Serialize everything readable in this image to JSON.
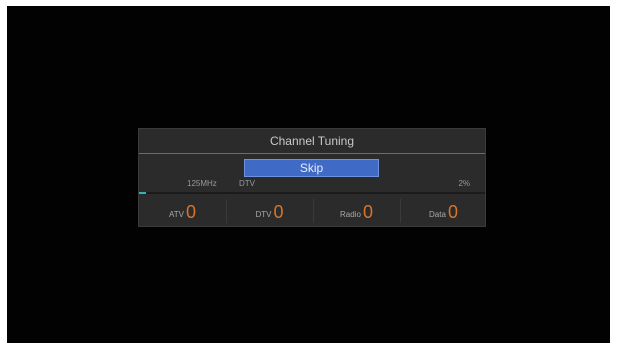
{
  "dialog": {
    "title": "Channel Tuning",
    "skip_label": "Skip",
    "frequency": "125MHz",
    "mode": "DTV",
    "percent": "2%",
    "progress_fraction": 0.02
  },
  "counts": [
    {
      "label": "ATV",
      "value": "0"
    },
    {
      "label": "DTV",
      "value": "0"
    },
    {
      "label": "Radio",
      "value": "0"
    },
    {
      "label": "Data",
      "value": "0"
    }
  ],
  "colors": {
    "background": "#020202",
    "panel": "#2b2b2b",
    "accent_blue": "#3f6bc6",
    "count_orange": "#d9742b",
    "progress": "#2fb6b4"
  }
}
